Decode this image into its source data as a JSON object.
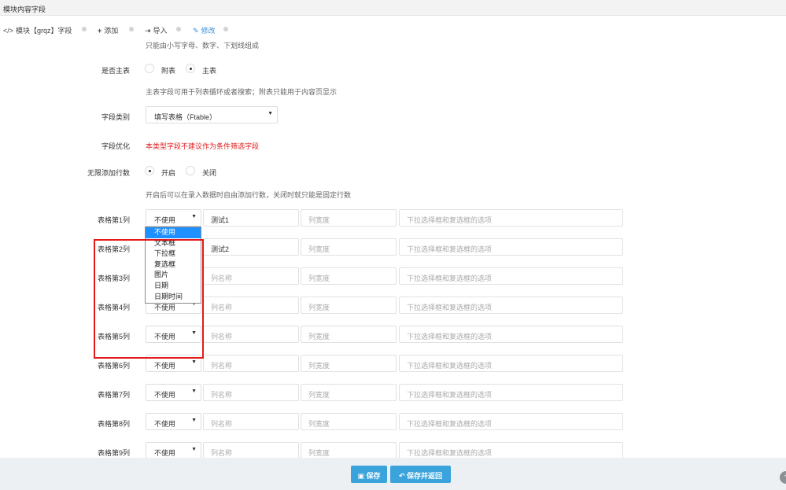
{
  "window": {
    "title": "模块内容字段"
  },
  "toolbar": {
    "module_label": "模块【grqz】字段",
    "add_label": "添加",
    "import_label": "导入",
    "edit_label": "修改"
  },
  "form": {
    "name_help": "只能由小写字母、数字、下划线组成",
    "is_main": {
      "label": "是否主表",
      "options": [
        "附表",
        "主表"
      ],
      "selected": "主表",
      "help": "主表字段可用于列表循环或者搜索；附表只能用于内容页显示"
    },
    "field_type": {
      "label": "字段类别",
      "value": "填写表格（Ftable）"
    },
    "field_opt": {
      "label": "字段优化",
      "warning": "本类型字段不建议作为条件筛选字段"
    },
    "unlimited_rows": {
      "label": "无限添加行数",
      "options": [
        "开启",
        "关闭"
      ],
      "selected": "开启",
      "help": "开启后可以在录入数据时自由添加行数，关闭时就只能是固定行数"
    },
    "columns": [
      {
        "label": "表格第1列",
        "type": "不使用",
        "name": "测试1",
        "name_placeholder": "列名称",
        "width_placeholder": "列宽度",
        "options_placeholder": "下拉选择框和复选框的选项"
      },
      {
        "label": "表格第2列",
        "type": "不使用",
        "name": "测试2",
        "name_placeholder": "列名称",
        "width_placeholder": "列宽度",
        "options_placeholder": "下拉选择框和复选框的选项"
      },
      {
        "label": "表格第3列",
        "type": "不使用",
        "name": "",
        "name_placeholder": "列名称",
        "width_placeholder": "列宽度",
        "options_placeholder": "下拉选择框和复选框的选项"
      },
      {
        "label": "表格第4列",
        "type": "不使用",
        "name": "",
        "name_placeholder": "列名称",
        "width_placeholder": "列宽度",
        "options_placeholder": "下拉选择框和复选框的选项"
      },
      {
        "label": "表格第5列",
        "type": "不使用",
        "name": "",
        "name_placeholder": "列名称",
        "width_placeholder": "列宽度",
        "options_placeholder": "下拉选择框和复选框的选项"
      },
      {
        "label": "表格第6列",
        "type": "不使用",
        "name": "",
        "name_placeholder": "列名称",
        "width_placeholder": "列宽度",
        "options_placeholder": "下拉选择框和复选框的选项"
      },
      {
        "label": "表格第7列",
        "type": "不使用",
        "name": "",
        "name_placeholder": "列名称",
        "width_placeholder": "列宽度",
        "options_placeholder": "下拉选择框和复选框的选项"
      },
      {
        "label": "表格第8列",
        "type": "不使用",
        "name": "",
        "name_placeholder": "列名称",
        "width_placeholder": "列宽度",
        "options_placeholder": "下拉选择框和复选框的选项"
      },
      {
        "label": "表格第9列",
        "type": "不使用",
        "name": "",
        "name_placeholder": "列名称",
        "width_placeholder": "列宽度",
        "options_placeholder": "下拉选择框和复选框的选项"
      }
    ],
    "type_dropdown": {
      "options": [
        "不使用",
        "文本框",
        "下拉框",
        "复选框",
        "图片",
        "日期",
        "日期时间"
      ],
      "highlighted": "不使用"
    }
  },
  "footer": {
    "save_label": "保存",
    "save_return_label": "保存并返回"
  },
  "colors": {
    "accent": "#3aa3db",
    "warning": "#e02020",
    "highlight": "#e41a1a",
    "selection": "#1e90ff"
  }
}
